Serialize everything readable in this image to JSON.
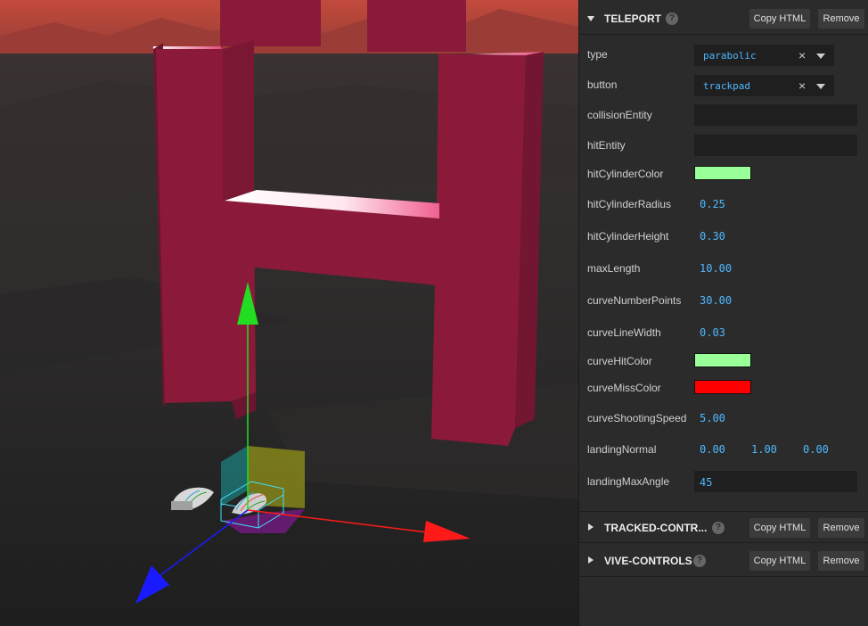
{
  "scene": {
    "sky_color": "#b7453b",
    "ground_color": "#262626",
    "letter_color": "#8b1a3a",
    "axis_colors": {
      "x": "#ff1a1a",
      "y": "#22dd22",
      "z": "#1a1aff"
    }
  },
  "teleport": {
    "title": "TELEPORT",
    "help_icon": "question-circle-icon",
    "copy_label": "Copy HTML",
    "remove_label": "Remove",
    "props": {
      "type": {
        "label": "type",
        "value": "parabolic"
      },
      "button": {
        "label": "button",
        "value": "trackpad"
      },
      "collisionEntity": {
        "label": "collisionEntity",
        "value": ""
      },
      "hitEntity": {
        "label": "hitEntity",
        "value": ""
      },
      "hitCylinderColor": {
        "label": "hitCylinderColor",
        "color": "#99ff99"
      },
      "hitCylinderRadius": {
        "label": "hitCylinderRadius",
        "value": "0.25"
      },
      "hitCylinderHeight": {
        "label": "hitCylinderHeight",
        "value": "0.30"
      },
      "maxLength": {
        "label": "maxLength",
        "value": "10.00"
      },
      "curveNumberPoints": {
        "label": "curveNumberPoints",
        "value": "30.00"
      },
      "curveLineWidth": {
        "label": "curveLineWidth",
        "value": "0.03"
      },
      "curveHitColor": {
        "label": "curveHitColor",
        "color": "#99ff99"
      },
      "curveMissColor": {
        "label": "curveMissColor",
        "color": "#ff0000"
      },
      "curveShootingSpeed": {
        "label": "curveShootingSpeed",
        "value": "5.00"
      },
      "landingNormal": {
        "label": "landingNormal",
        "x": "0.00",
        "y": "1.00",
        "z": "0.00"
      },
      "landingMaxAngle": {
        "label": "landingMaxAngle",
        "value": "45"
      }
    }
  },
  "tracked_controls": {
    "title": "TRACKED-CONTR...",
    "copy_label": "Copy HTML",
    "remove_label": "Remove"
  },
  "vive_controls": {
    "title": "VIVE-CONTROLS",
    "copy_label": "Copy HTML",
    "remove_label": "Remove"
  }
}
